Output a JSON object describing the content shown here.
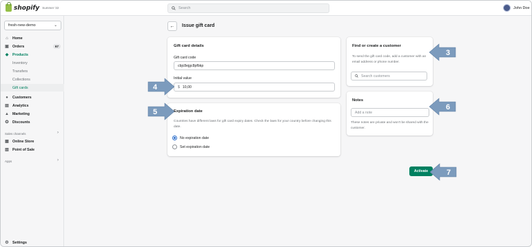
{
  "topbar": {
    "brand": "shopify",
    "edition": "Summer '22",
    "search_placeholder": "Search",
    "user_name": "John Doe"
  },
  "sidebar": {
    "store_name": "fresh-new-demo",
    "items": [
      {
        "label": "Home",
        "icon": "home-icon"
      },
      {
        "label": "Orders",
        "icon": "orders-icon",
        "badge": "67"
      },
      {
        "label": "Products",
        "icon": "tag-icon"
      },
      {
        "label": "Inventory"
      },
      {
        "label": "Transfers"
      },
      {
        "label": "Collections"
      },
      {
        "label": "Gift cards"
      },
      {
        "label": "Customers",
        "icon": "person-icon"
      },
      {
        "label": "Analytics",
        "icon": "analytics-icon"
      },
      {
        "label": "Marketing",
        "icon": "marketing-icon"
      },
      {
        "label": "Discounts",
        "icon": "discount-icon"
      }
    ],
    "sales_channels_label": "Sales channels",
    "channels": [
      {
        "label": "Online Store",
        "icon": "store-icon"
      },
      {
        "label": "Point of Sale",
        "icon": "pos-icon"
      }
    ],
    "apps_label": "Apps",
    "settings_label": "Settings"
  },
  "page": {
    "title": "Issue gift card"
  },
  "gift_card_details": {
    "title": "Gift card details",
    "code_label": "Gift card code",
    "code_value": "cbjc8ejgc8pfbkp",
    "initial_value_label": "Initial value",
    "currency_symbol": "$",
    "initial_value": "10,00"
  },
  "expiration": {
    "title": "Expiration date",
    "help": "Countries have different laws for gift card expiry dates. Check the laws for your country before changing this date.",
    "options": [
      "No expiration date",
      "Set expiration date"
    ],
    "selected": "No expiration date"
  },
  "customer": {
    "title": "Find or create a customer",
    "help": "To send the gift card code, add a customer with an email address or phone number.",
    "search_placeholder": "Search customers"
  },
  "notes": {
    "title": "Notes",
    "placeholder": "Add a note",
    "help": "These notes are private and won't be shared with the customer."
  },
  "actions": {
    "activate_label": "Activate"
  },
  "annotations": {
    "color": "#7c9bbd",
    "callouts": [
      "3",
      "4",
      "5",
      "6",
      "7"
    ]
  }
}
